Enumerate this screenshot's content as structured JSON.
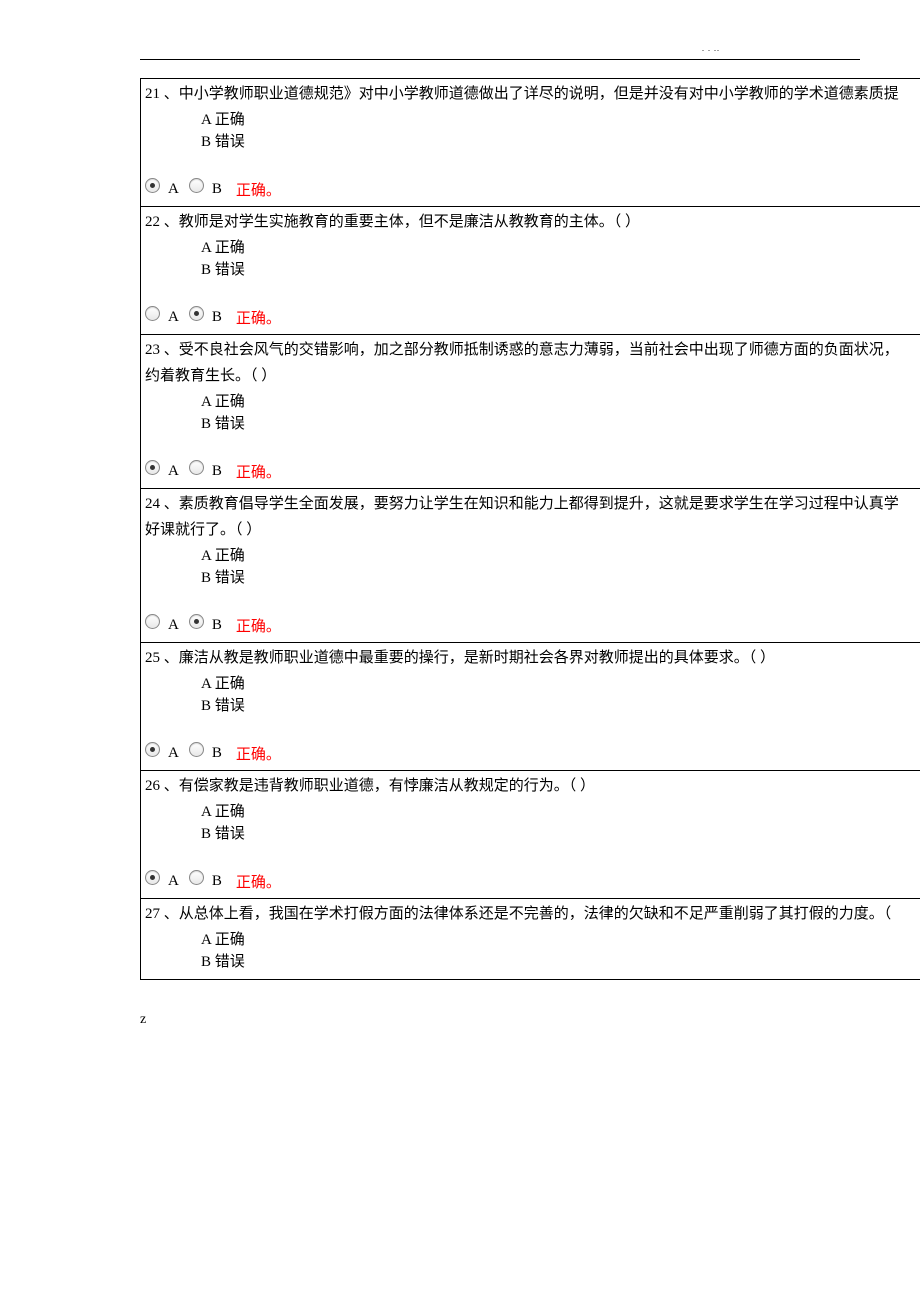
{
  "header_dots": ". . ..",
  "footer": "z",
  "labels": {
    "opt_a_prefix": "A",
    "opt_b_prefix": "B",
    "correct_text": "正确。"
  },
  "questions": [
    {
      "num": "21",
      "sep": "、",
      "stem": "中小学教师职业道德规范》对中小学教师道德做出了详尽的说明，但是并没有对中小学教师的学术道德素质提",
      "opt_a": "正确",
      "opt_b": "错误",
      "selected": "A"
    },
    {
      "num": "22",
      "sep": "、",
      "stem": "教师是对学生实施教育的重要主体，但不是廉洁从教教育的主体。（ ）",
      "opt_a": "正确",
      "opt_b": "错误",
      "selected": "B"
    },
    {
      "num": "23",
      "sep": "、",
      "stem": "受不良社会风气的交错影响，加之部分教师抵制诱惑的意志力薄弱，当前社会中出现了师德方面的负面状况，",
      "stem2": "约着教育生长。（ ）",
      "opt_a": "正确",
      "opt_b": "错误",
      "selected": "A"
    },
    {
      "num": "24",
      "sep": "、",
      "stem": "素质教育倡导学生全面发展，要努力让学生在知识和能力上都得到提升，这就是要求学生在学习过程中认真学",
      "stem2": "好课就行了。（ ）",
      "opt_a": "正确",
      "opt_b": "错误",
      "selected": "B"
    },
    {
      "num": "25",
      "sep": "、",
      "stem": "廉洁从教是教师职业道德中最重要的操行，是新时期社会各界对教师提出的具体要求。（ ）",
      "opt_a": "正确",
      "opt_b": "错误",
      "selected": "A"
    },
    {
      "num": "26",
      "sep": "、",
      "stem": "有偿家教是违背教师职业道德，有悖廉洁从教规定的行为。（ ）",
      "opt_a": "正确",
      "opt_b": "错误",
      "selected": "A"
    },
    {
      "num": "27",
      "sep": "、",
      "stem": "从总体上看，我国在学术打假方面的法律体系还是不完善的，法律的欠缺和不足严重削弱了其打假的力度。（",
      "opt_a": "正确",
      "opt_b": "错误",
      "selected": null
    }
  ]
}
